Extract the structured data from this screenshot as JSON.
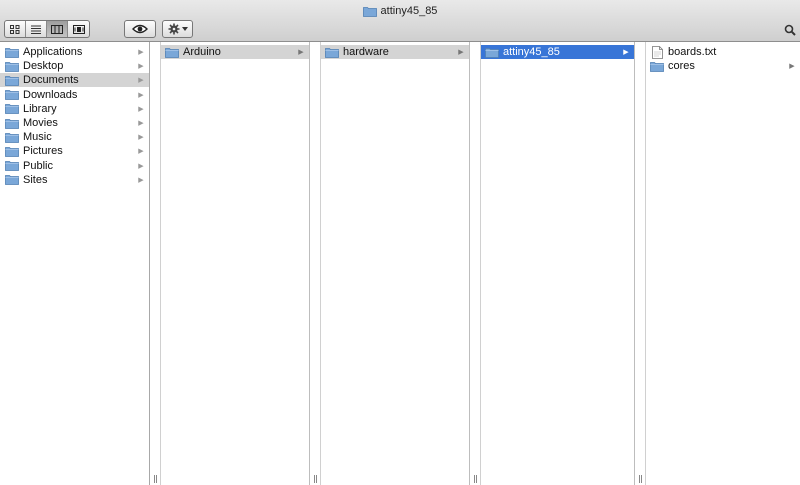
{
  "window": {
    "title": "attiny45_85"
  },
  "toolbar": {
    "view_buttons": [
      "icon-view",
      "list-view",
      "column-view",
      "coverflow-view"
    ],
    "active_view": "column-view",
    "quicklook_icon": "eye-icon",
    "action_icon": "gear-icon",
    "search_icon": "search-icon"
  },
  "sidebar": {
    "items": [
      {
        "label": "Applications"
      },
      {
        "label": "Desktop"
      },
      {
        "label": "Documents"
      },
      {
        "label": "Downloads"
      },
      {
        "label": "Library"
      },
      {
        "label": "Movies"
      },
      {
        "label": "Music"
      },
      {
        "label": "Pictures"
      },
      {
        "label": "Public"
      },
      {
        "label": "Sites"
      }
    ],
    "selected": "Documents"
  },
  "columns": [
    {
      "items": [
        {
          "label": "Arduino",
          "type": "folder"
        }
      ],
      "selected": "Arduino"
    },
    {
      "items": [
        {
          "label": "hardware",
          "type": "folder"
        }
      ],
      "selected": "hardware"
    },
    {
      "items": [
        {
          "label": "attiny45_85",
          "type": "folder"
        }
      ],
      "selected": "attiny45_85"
    },
    {
      "items": [
        {
          "label": "boards.txt",
          "type": "file"
        },
        {
          "label": "cores",
          "type": "folder"
        }
      ],
      "selected": ""
    }
  ],
  "colors": {
    "selection_blue": "#3875d7",
    "selection_gray": "#d4d4d4",
    "folder_blue": "#7aa7d8"
  }
}
